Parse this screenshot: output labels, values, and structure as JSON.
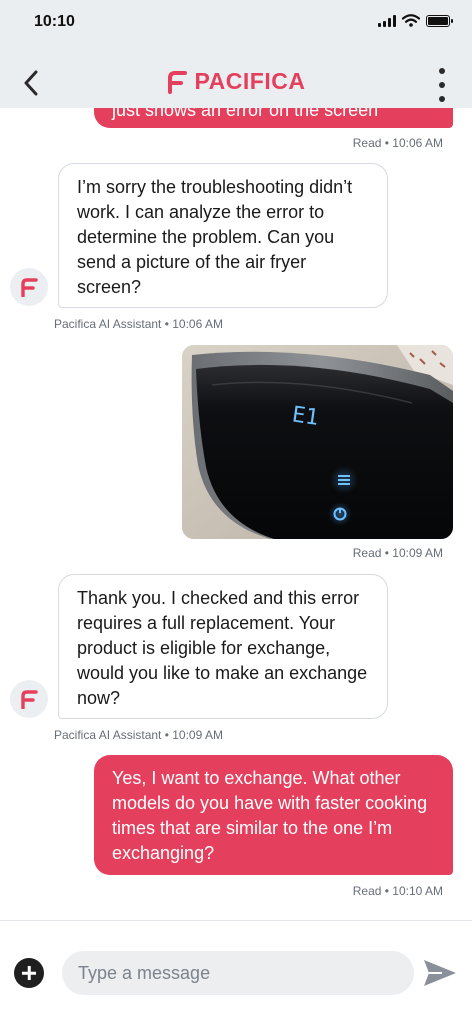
{
  "status_bar": {
    "time": "10:10"
  },
  "header": {
    "brand_name": "PACIFICA"
  },
  "messages": [
    {
      "sender": "user",
      "text": "just shows an error on the screen",
      "meta": "Read • 10:06 AM"
    },
    {
      "sender": "assistant",
      "text": "I’m sorry the troubleshooting didn’t work. I can analyze the error to determine the problem. Can you send a picture of the air fryer screen?",
      "meta": "Pacifica AI Assistant • 10:06 AM"
    },
    {
      "sender": "user",
      "type": "image",
      "display_code": "E1",
      "meta": "Read • 10:09 AM"
    },
    {
      "sender": "assistant",
      "text": "Thank you. I checked and this error requires a full replacement. Your product is eligible for exchange, would you like to make an exchange now?",
      "meta": "Pacifica AI Assistant • 10:09 AM"
    },
    {
      "sender": "user",
      "text": "Yes, I want to exchange. What other models do you have with faster cooking times that are similar to the one I’m exchanging?",
      "meta": "Read • 10:10 AM"
    }
  ],
  "composer": {
    "placeholder": "Type a message"
  },
  "colors": {
    "accent": "#e4405d",
    "header_bg": "#ebeef1",
    "input_bg": "#eceef0"
  },
  "icons": {
    "back": "chevron-left-icon",
    "more": "kebab-menu-icon",
    "add": "plus-circle-icon",
    "send": "send-icon",
    "brand": "pacifica-logo-icon"
  }
}
